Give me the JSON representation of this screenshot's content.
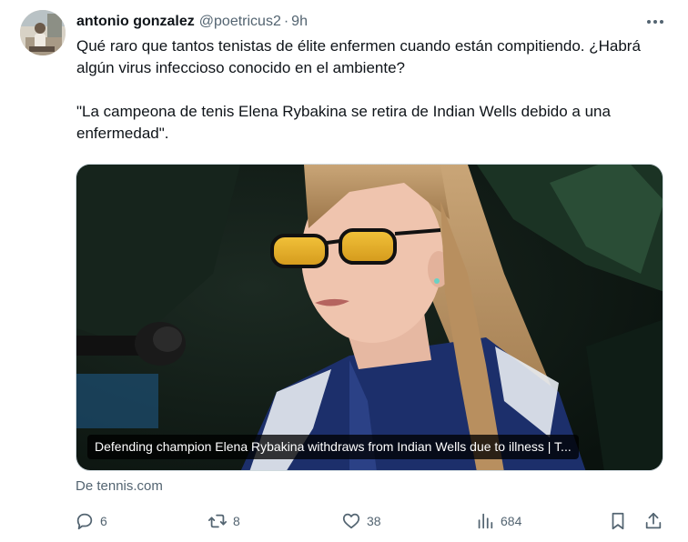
{
  "author": {
    "name": "antonio gonzalez",
    "handle": "@poetricus2",
    "separator": "·",
    "time": "9h"
  },
  "tweet": {
    "paragraph1": "Qué raro que tantos tenistas de élite enfermen cuando están compitiendo. ¿Habrá algún virus infeccioso conocido en el ambiente?",
    "paragraph2": "\"La campeona de tenis Elena Rybakina se retira de Indian Wells debido a una enfermedad\"."
  },
  "card": {
    "caption": "Defending champion Elena Rybakina withdraws from Indian Wells due to illness | T...",
    "source": "De tennis.com"
  },
  "actions": {
    "replies": "6",
    "reposts": "8",
    "likes": "38",
    "views": "684"
  },
  "colors": {
    "text": "#0f1419",
    "secondary": "#536471",
    "border": "#cfd9de"
  },
  "icons": [
    "more-icon",
    "reply-icon",
    "repost-icon",
    "like-icon",
    "views-icon",
    "bookmark-icon",
    "share-icon"
  ]
}
